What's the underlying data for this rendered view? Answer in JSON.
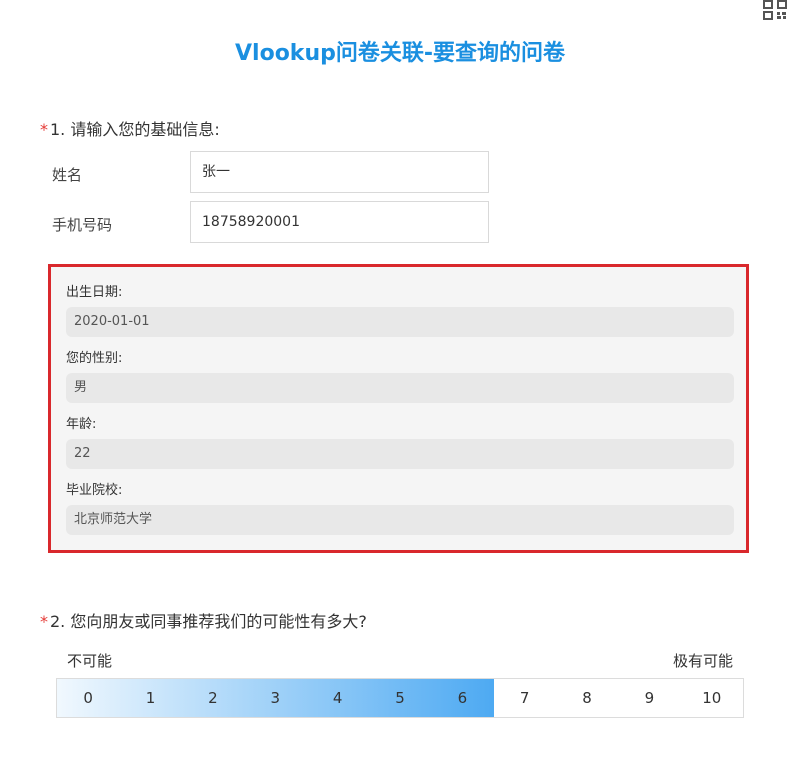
{
  "title": "Vlookup问卷关联-要查询的问卷",
  "q1": {
    "required_mark": "*",
    "title": "1. 请输入您的基础信息:",
    "fields": [
      {
        "label": "姓名",
        "value": "张一"
      },
      {
        "label": "手机号码",
        "value": "18758920001"
      }
    ],
    "lookup": [
      {
        "label": "出生日期:",
        "value": "2020-01-01"
      },
      {
        "label": "您的性别:",
        "value": "男"
      },
      {
        "label": "年龄:",
        "value": "22"
      },
      {
        "label": "毕业院校:",
        "value": "北京师范大学"
      }
    ]
  },
  "q2": {
    "required_mark": "*",
    "title": "2. 您向朋友或同事推荐我们的可能性有多大?",
    "left_label": "不可能",
    "right_label": "极有可能",
    "scale": [
      "0",
      "1",
      "2",
      "3",
      "4",
      "5",
      "6",
      "7",
      "8",
      "9",
      "10"
    ],
    "selected": 6,
    "accent": "#4aa8f2"
  },
  "icons": {
    "qr": "qr-code-icon"
  }
}
